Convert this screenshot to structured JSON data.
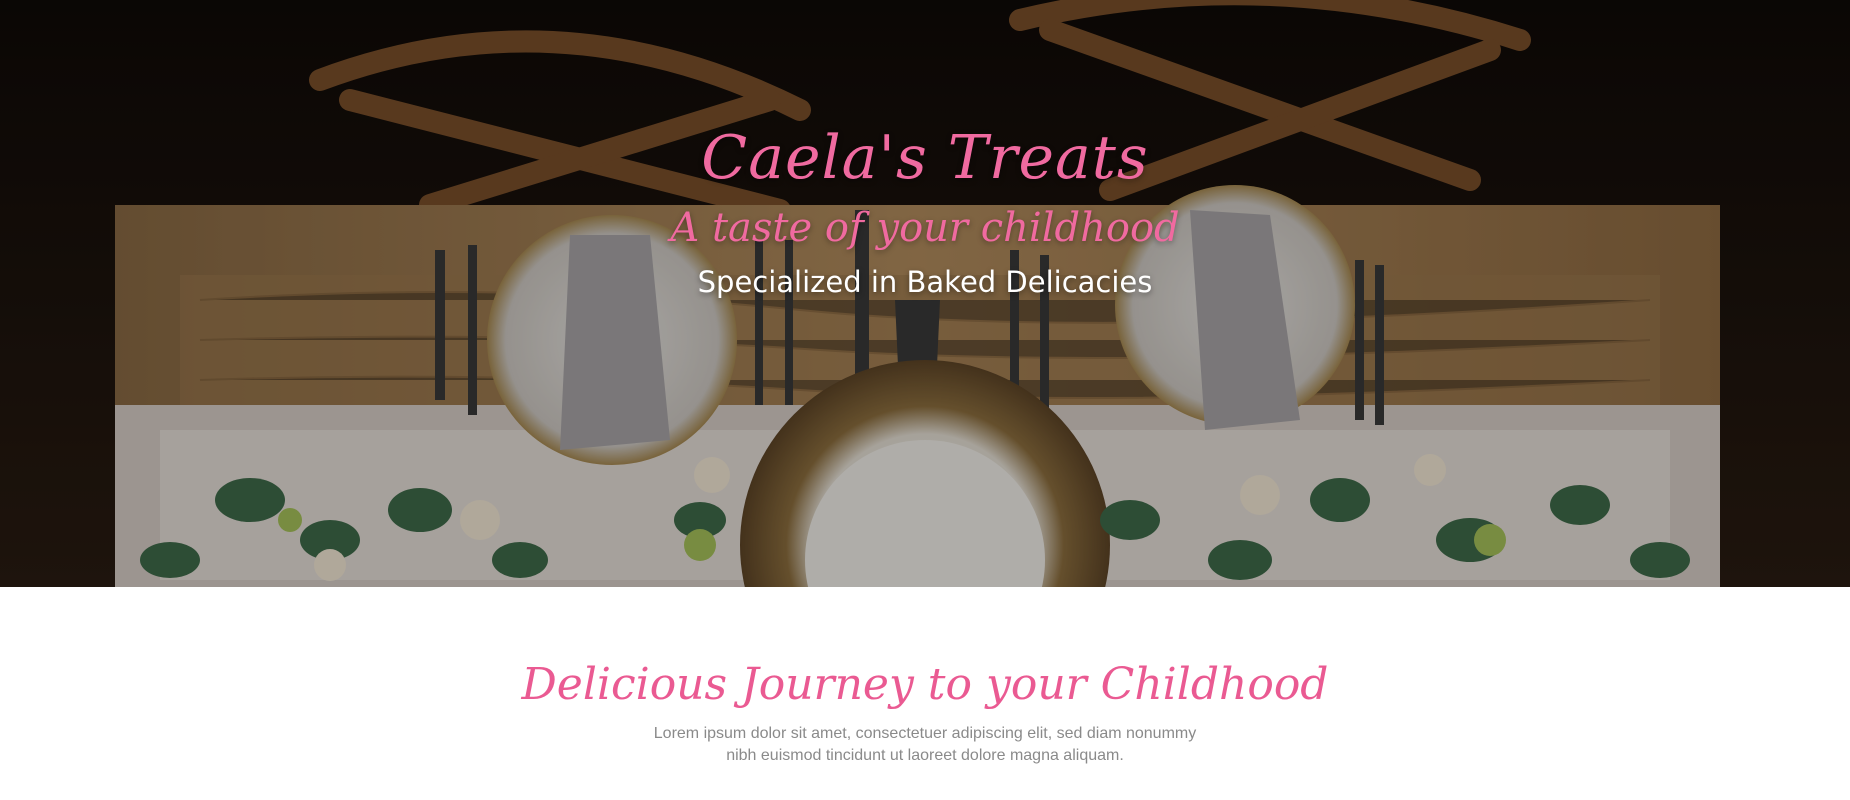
{
  "hero": {
    "title": "Caela's Treats",
    "tagline": "A taste of your childhood",
    "subtitle": "Specialized in Baked Delicacies",
    "background_image": "table-setting-photo"
  },
  "intro": {
    "heading": "Delicious Journey to your Childhood",
    "body": "Lorem ipsum dolor sit amet, consectetuer adipiscing elit, sed diam nonummy nibh euismod tincidunt ut laoreet dolore magna aliquam."
  },
  "colors": {
    "accent_pink": "#f06aa0",
    "heading_pink": "#ea5a92",
    "body_gray": "#8a8a8a"
  }
}
